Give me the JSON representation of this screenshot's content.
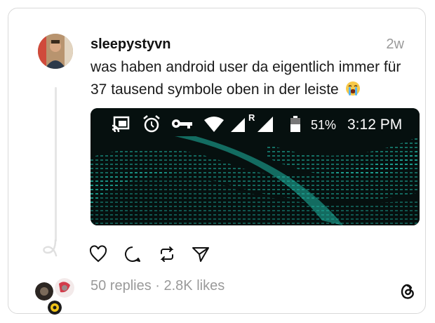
{
  "post": {
    "username": "sleepystyvn",
    "time": "2w",
    "text": "was haben android user da eigentlich immer für 37 tausend symbole oben in der leiste",
    "emoji": "loudly-crying-face-emoji"
  },
  "media": {
    "status_bar": {
      "icons": [
        "cast-icon",
        "alarm-clock-icon",
        "vpn-key-icon",
        "wifi-icon",
        "signal-roaming-icon",
        "signal-icon",
        "battery-icon"
      ],
      "roaming_label": "R",
      "battery_percent": "51%",
      "clock": "3:12 PM"
    },
    "background_color": "#0f2f2b",
    "accent": "#23d6c0"
  },
  "actions": {
    "icons": [
      "heart-icon",
      "comment-icon",
      "repost-icon",
      "share-icon"
    ]
  },
  "engagement": {
    "stats": "50 replies · 2.8K likes"
  },
  "colors": {
    "border": "#d9d9d9",
    "muted_text": "#9a9a9a",
    "text": "#1a1a1a"
  }
}
